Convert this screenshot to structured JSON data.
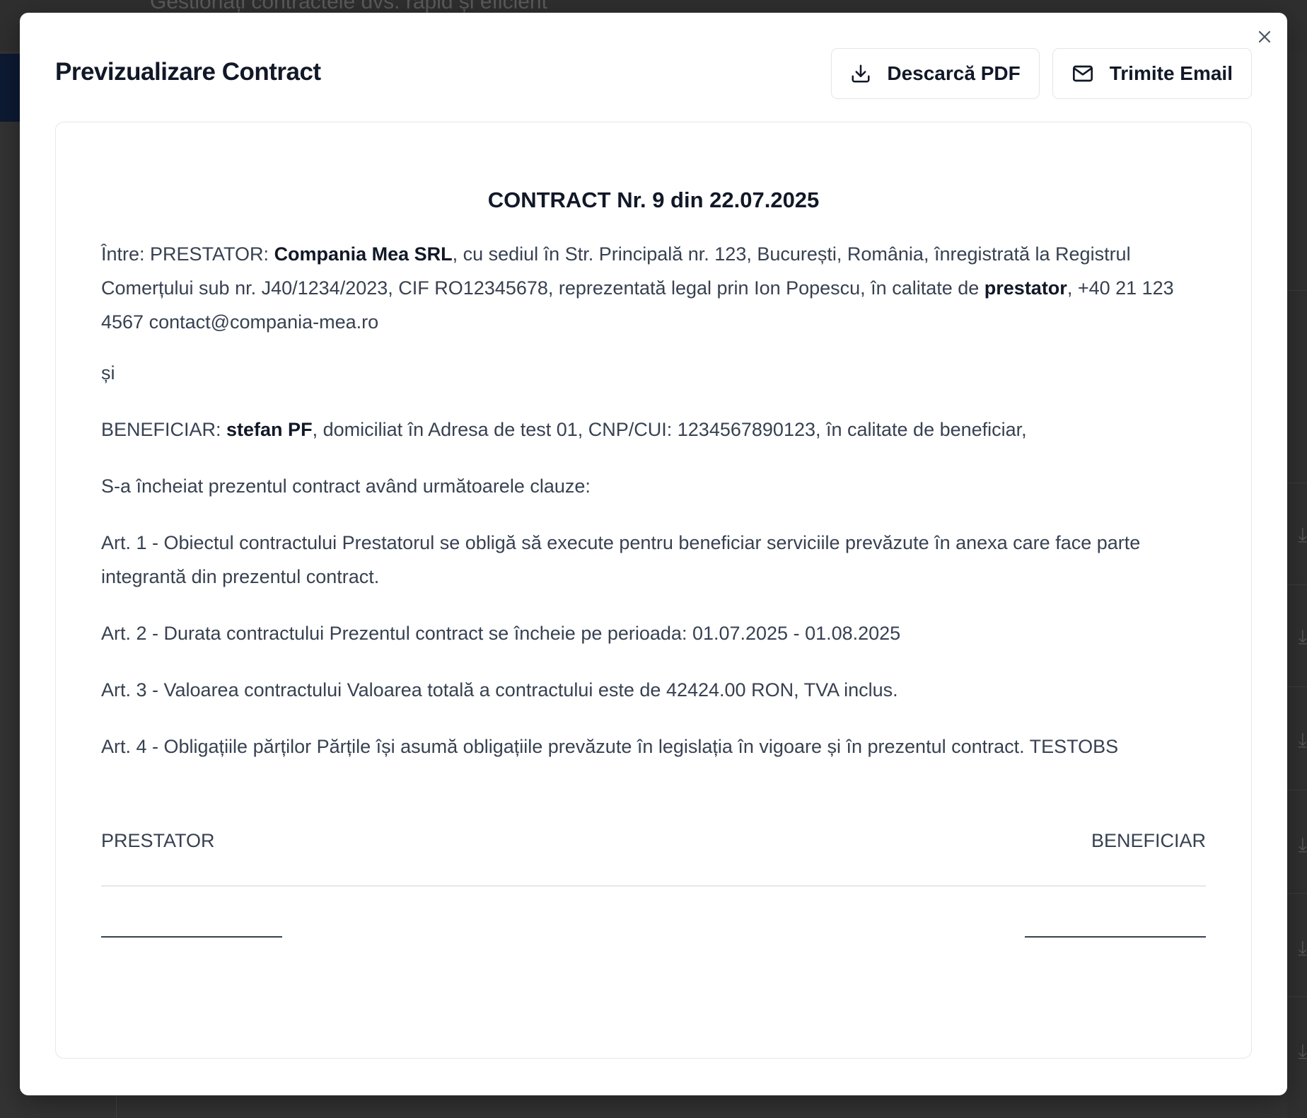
{
  "background": {
    "subtitle": "Gestionați contractele dvs. rapid și eficient"
  },
  "modal": {
    "title": "Previzualizare Contract",
    "close_icon": "close-icon",
    "buttons": {
      "download": {
        "label": "Descarcă PDF",
        "icon": "download-icon"
      },
      "email": {
        "label": "Trimite Email",
        "icon": "mail-icon"
      }
    }
  },
  "contract": {
    "title": "CONTRACT Nr. 9 din 22.07.2025",
    "intro": {
      "prefix": "Între: PRESTATOR: ",
      "provider_name": "Compania Mea SRL",
      "provider_details": ", cu sediul în Str. Principală nr. 123, București, România, înregistrată la Registrul Comerțului sub nr. J40/1234/2023, CIF RO12345678, reprezentată legal prin Ion Popescu, în calitate de ",
      "provider_role": "prestator",
      "provider_contact": ", +40 21 123 4567 contact@compania-mea.ro"
    },
    "conjunction": "și",
    "beneficiary": {
      "prefix": "BENEFICIAR: ",
      "name": "stefan PF",
      "details": ", domiciliat în Adresa de test 01, CNP/CUI: 1234567890123, în calitate de beneficiar,"
    },
    "clauses_intro": "S-a încheiat prezentul contract având următoarele clauze:",
    "articles": [
      "Art. 1 - Obiectul contractului Prestatorul se obligă să execute pentru beneficiar serviciile prevăzute în anexa care face parte integrantă din prezentul contract.",
      "Art. 2 - Durata contractului Prezentul contract se încheie pe perioada: 01.07.2025 - 01.08.2025",
      "Art. 3 - Valoarea contractului Valoarea totală a contractului este de 42424.00 RON, TVA inclus.",
      "Art. 4 - Obligațiile părților Părțile își asumă obligațiile prevăzute în legislația în vigoare și în prezentul contract. TESTOBS"
    ],
    "signatures": {
      "left_label": "PRESTATOR",
      "right_label": "BENEFICIAR"
    }
  }
}
